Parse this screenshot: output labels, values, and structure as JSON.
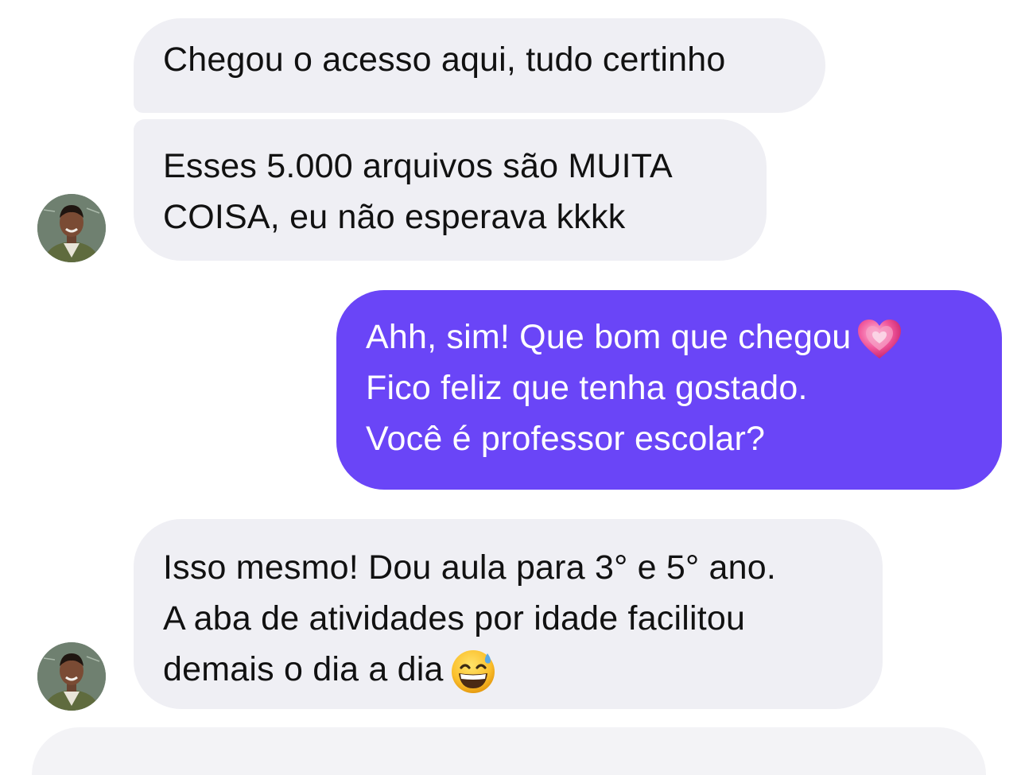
{
  "chat": {
    "messages": [
      {
        "direction": "incoming",
        "lines": [
          "Chegou o acesso aqui, tudo certinho"
        ]
      },
      {
        "direction": "incoming",
        "lines": [
          "Esses 5.000 arquivos são MUITA",
          "COISA, eu não esperava kkkk"
        ]
      },
      {
        "direction": "outgoing",
        "lines": [
          "Ahh, sim! Que bom que chegou",
          "Fico feliz que tenha gostado.",
          "Você é professor escolar?"
        ],
        "emoji_after_line_1": "growing-heart-emoji"
      },
      {
        "direction": "incoming",
        "lines": [
          "Isso mesmo! Dou aula para 3° e 5° ano.",
          "A aba de atividades por idade facilitou",
          "demais o dia a dia"
        ],
        "emoji_after_line_3": "grinning-sweat-emoji"
      }
    ],
    "avatar_icon": "contact-avatar-photo"
  },
  "colors": {
    "incoming_bubble": "#efeff4",
    "outgoing_bubble": "#6a45f7",
    "incoming_text": "#111111",
    "outgoing_text": "#ffffff"
  }
}
